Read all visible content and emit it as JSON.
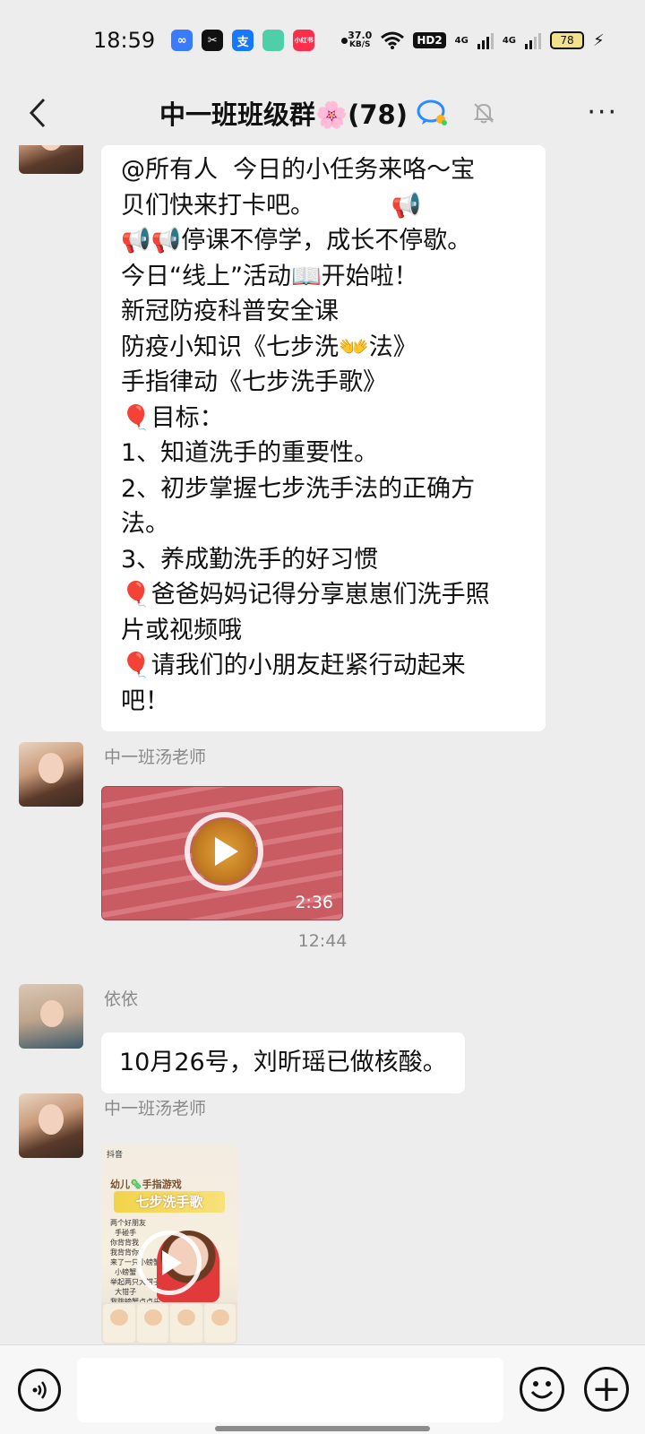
{
  "status_bar": {
    "time": "18:59",
    "net_speed_value": "37.0",
    "net_speed_unit": "KB/S",
    "hd_label": "HD2",
    "signal_1": "4G",
    "signal_2": "4G",
    "battery": "78",
    "notif_icons": [
      "infinity-app-icon",
      "capcut-app-icon",
      "alipay-app-icon",
      "green-app-icon",
      "xiaohongshu-app-icon"
    ],
    "notif_labels": [
      "∞",
      "✂",
      "支",
      "",
      "小红书"
    ],
    "notif_colors": [
      "#3a7bfd",
      "#111111",
      "#1677ff",
      "#4fcfa8",
      "#ff2e4d"
    ]
  },
  "header": {
    "back_label": "‹",
    "title": "中一班班级群🌸(78)",
    "more_label": "···"
  },
  "messages": {
    "msg1_lines": [
      "@所有人  今日的小任务来咯～宝",
      "贝们快来打卡吧。          📢",
      "📢📢停课不停学，成长不停歇。",
      "今日“线上”活动📖开始啦！",
      "新冠防疫科普安全课",
      "防疫小知识《七步洗👐法》",
      "手指律动《七步洗手歌》",
      "🎈目标：",
      "1、知道洗手的重要性。",
      "2、初步掌握七步洗手法的正确方",
      "法。",
      "3、养成勤洗手的好习惯",
      "🎈爸爸妈妈记得分享崽崽们洗手照",
      "片或视频哦",
      "🎈请我们的小朋友赶紧行动起来",
      "吧！"
    ],
    "msg2_sender": "中一班汤老师",
    "msg2_duration": "2:36",
    "time_separator": "12:44",
    "msg3_sender": "依依",
    "msg3_text": "10月26号，刘昕瑶已做核酸。",
    "msg4_sender": "中一班汤老师",
    "msg4_video": {
      "brand": "抖音",
      "title_small": "幼儿🦠手指游戏",
      "title_main": "七步洗手歌",
      "lyrics": "两个好朋友\n  手碰手\n你背背我\n我背背你\n来了一只小螃蟹\n  小螃蟹\n举起两只大钳子\n  大钳子\n我跳螃蟹点点头\n  点点头\n螃蟹跳我握握手\n  握握手"
    }
  },
  "input_bar": {
    "placeholder": "",
    "plus_label": "+"
  }
}
